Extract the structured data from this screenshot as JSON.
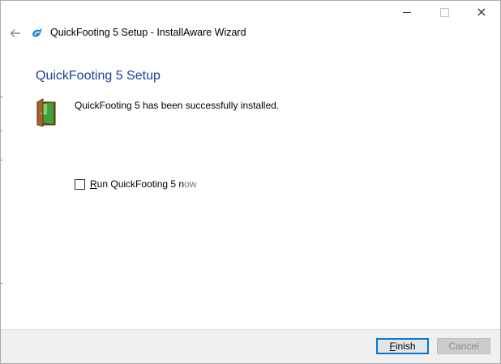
{
  "window": {
    "title": "QuickFooting 5 Setup - InstallAware Wizard",
    "controls": {
      "minimize": "minimize",
      "maximize": "maximize",
      "close": "×"
    }
  },
  "page": {
    "heading": "QuickFooting 5 Setup",
    "message": "QuickFooting 5 has been successfully installed.",
    "run_checkbox": {
      "label_first": "R",
      "label_rest": "un QuickFooting 5 n",
      "label_faded": "ow",
      "checked": false
    }
  },
  "footer": {
    "finish_underlined": "F",
    "finish_rest": "inish",
    "cancel_label": "Cancel"
  },
  "colors": {
    "heading": "#1f3f9a",
    "accent": "#0078d7",
    "footer_bg": "#f0f0f0"
  },
  "icons": [
    "back-arrow-icon",
    "installaware-icon",
    "setup-door-icon"
  ]
}
